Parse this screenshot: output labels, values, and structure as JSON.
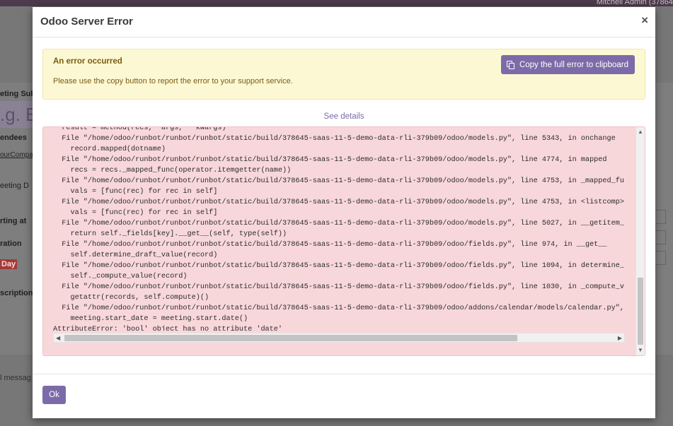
{
  "background": {
    "user_name": "Mitchell Admin (37864",
    "labels": [
      "eting Sub",
      "endees",
      "eeting D",
      "rting at",
      "ration",
      "scription"
    ],
    "subject_placeholder": ".g. B",
    "company_link": "ourCompa",
    "all_day_tag": "Day",
    "message_hint": "l messag"
  },
  "dialog": {
    "title": "Odoo Server Error",
    "close_symbol": "×",
    "alert": {
      "title": "An error occurred",
      "text": "Please use the copy button to report the error to your support service.",
      "copy_button": "Copy the full error to clipboard"
    },
    "see_details": "See details",
    "traceback": [
      "  result = method(recs, *args, **kwargs)",
      "  File \"/home/odoo/runbot/runbot/runbot/static/build/378645-saas-11-5-demo-data-rli-379b09/odoo/models.py\", line 5343, in onchange",
      "    record.mapped(dotname)",
      "  File \"/home/odoo/runbot/runbot/runbot/static/build/378645-saas-11-5-demo-data-rli-379b09/odoo/models.py\", line 4774, in mapped",
      "    recs = recs._mapped_func(operator.itemgetter(name))",
      "  File \"/home/odoo/runbot/runbot/runbot/static/build/378645-saas-11-5-demo-data-rli-379b09/odoo/models.py\", line 4753, in _mapped_fu",
      "    vals = [func(rec) for rec in self]",
      "  File \"/home/odoo/runbot/runbot/runbot/static/build/378645-saas-11-5-demo-data-rli-379b09/odoo/models.py\", line 4753, in <listcomp>",
      "    vals = [func(rec) for rec in self]",
      "  File \"/home/odoo/runbot/runbot/runbot/static/build/378645-saas-11-5-demo-data-rli-379b09/odoo/models.py\", line 5027, in __getitem_",
      "    return self._fields[key].__get__(self, type(self))",
      "  File \"/home/odoo/runbot/runbot/runbot/static/build/378645-saas-11-5-demo-data-rli-379b09/odoo/fields.py\", line 974, in __get__",
      "    self.determine_draft_value(record)",
      "  File \"/home/odoo/runbot/runbot/runbot/static/build/378645-saas-11-5-demo-data-rli-379b09/odoo/fields.py\", line 1094, in determine_",
      "    self._compute_value(record)",
      "  File \"/home/odoo/runbot/runbot/runbot/static/build/378645-saas-11-5-demo-data-rli-379b09/odoo/fields.py\", line 1030, in _compute_v",
      "    getattr(records, self.compute)()",
      "  File \"/home/odoo/runbot/runbot/runbot/static/build/378645-saas-11-5-demo-data-rli-379b09/odoo/addons/calendar/models/calendar.py\",",
      "    meeting.start_date = meeting.start.date()",
      "AttributeError: 'bool' object has no attribute 'date'"
    ],
    "ok_button": "Ok"
  },
  "colors": {
    "primary": "#7c6ba8",
    "alert_bg": "#fcf8d4",
    "alert_text": "#7a5c12",
    "trace_bg": "#f8d7da"
  }
}
